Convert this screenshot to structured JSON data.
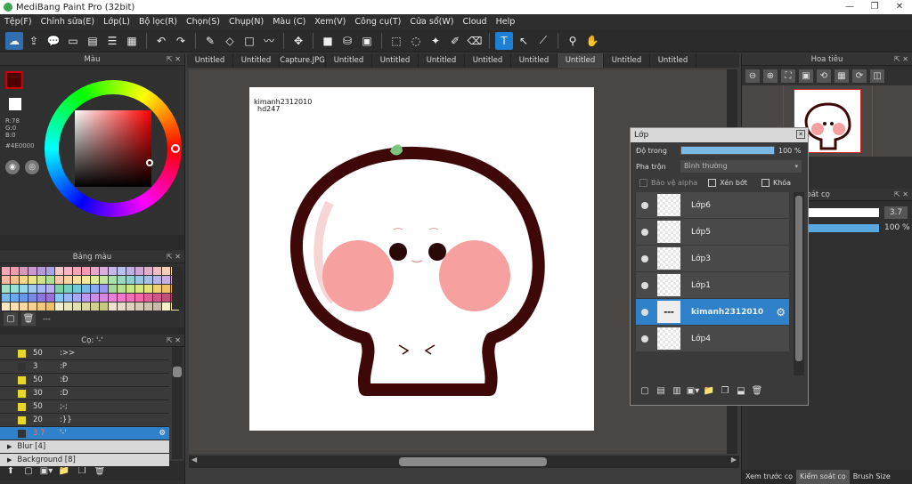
{
  "app": {
    "title": "MediBang Paint Pro (32bit)"
  },
  "menu": [
    "Tệp(F)",
    "Chỉnh sửa(E)",
    "Lớp(L)",
    "Bộ lọc(R)",
    "Chọn(S)",
    "Chụp(N)",
    "Màu (C)",
    "Xem(V)",
    "Công cụ(T)",
    "Cửa sổ(W)",
    "Cloud",
    "Help"
  ],
  "color_panel": {
    "title": "Màu",
    "r": "R:78",
    "g": "G:0",
    "b": "B:0",
    "hex": "#4E0000",
    "fg": "#4e0000",
    "bg": "#ffffff"
  },
  "palette_panel": {
    "title": "Bảng màu",
    "footer": "---"
  },
  "brush_panel": {
    "title": "Cọ: '-'",
    "items": [
      {
        "size": "50",
        "name": ":>>",
        "color": "#e8d72a"
      },
      {
        "size": "3",
        "name": ":P",
        "color": "#333333"
      },
      {
        "size": "50",
        "name": ":Đ",
        "color": "#e8d72a"
      },
      {
        "size": "30",
        "name": ":D",
        "color": "#e8d72a"
      },
      {
        "size": "50",
        "name": ";-;",
        "color": "#e8d72a"
      },
      {
        "size": "20",
        "name": ":}}",
        "color": "#e8d72a"
      },
      {
        "size": "3.7",
        "name": "'-'",
        "color": "#333333",
        "selected": true
      }
    ],
    "groups": [
      "Blur [4]",
      "Background [8]"
    ]
  },
  "tabs": [
    "Untitled",
    "Untitled",
    "Capture.JPG",
    "Untitled",
    "Untitled",
    "Untitled",
    "Untitled",
    "Untitled",
    "Untitled",
    "Untitled",
    "Untitled"
  ],
  "canvas": {
    "watermark_line1": "kimanh2312010",
    "watermark_line2": "hd247"
  },
  "navigator": {
    "title": "Hoa tiêu"
  },
  "brush_control": {
    "title": "n soát cọ",
    "size": "3.7",
    "opacity": "100 %"
  },
  "right_tabs": [
    "Xem trước cọ",
    "Kiểm soát cọ",
    "Brush Size"
  ],
  "layer_window": {
    "title": "Lớp",
    "opacity_label": "Độ trong",
    "opacity_value": "100 %",
    "opacity_pct": 100,
    "blend_label": "Pha trộn",
    "blend_value": "Bình thường",
    "protect_alpha": "Bảo vệ alpha",
    "clip": "Xén bớt",
    "lock": "Khóa",
    "layers": [
      {
        "name": "Lớp6"
      },
      {
        "name": "Lớp5"
      },
      {
        "name": "Lớp3"
      },
      {
        "name": "Lớp1"
      },
      {
        "name": "kimanh2312010",
        "selected": true
      },
      {
        "name": "Lớp4"
      }
    ]
  },
  "icons": {
    "close": "✕",
    "pin": "⇱"
  }
}
